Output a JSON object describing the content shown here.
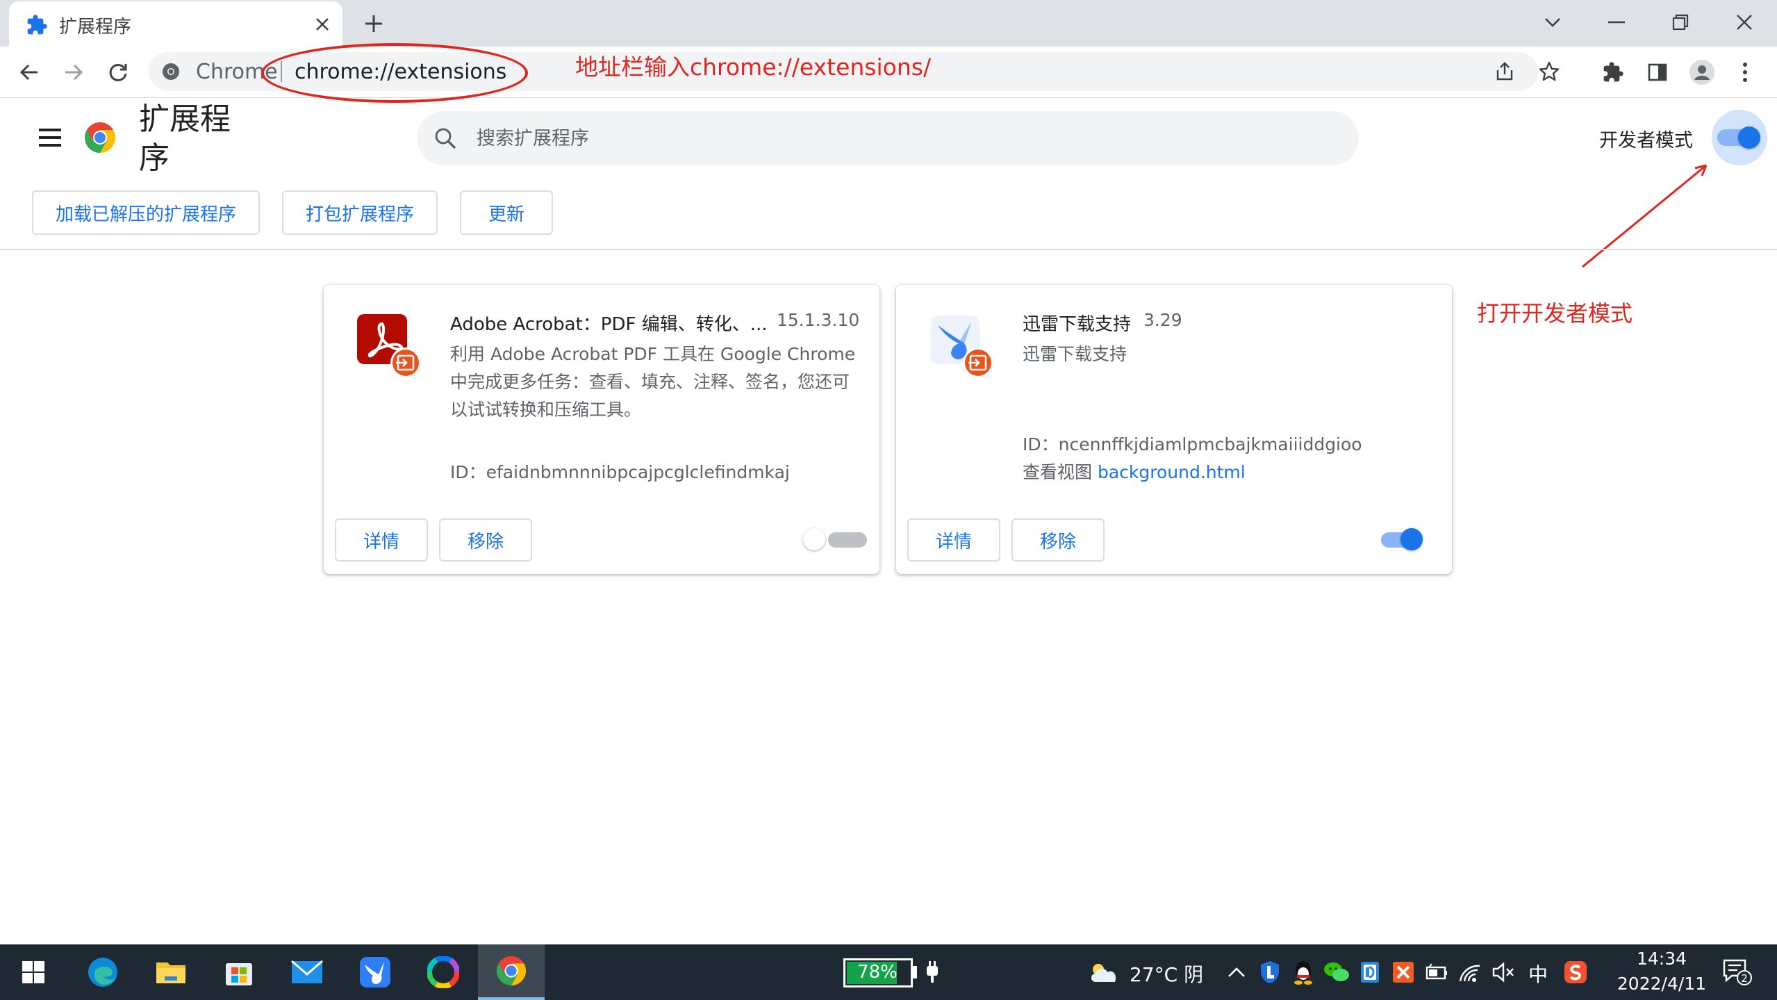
{
  "browser": {
    "tab_title": "扩展程序",
    "omnibox_scheme_label": "Chrome",
    "omnibox_url": "chrome://extensions"
  },
  "annotations": {
    "address_hint": "地址栏输入chrome://extensions/",
    "devmode_hint": "打开开发者模式",
    "color": "#e0261f"
  },
  "page": {
    "title": "扩展程序",
    "search_placeholder": "搜索扩展程序",
    "developer_mode_label": "开发者模式",
    "developer_mode_on": true,
    "buttons": {
      "load_unpacked": "加载已解压的扩展程序",
      "pack": "打包扩展程序",
      "update": "更新"
    }
  },
  "extensions": [
    {
      "name": "Adobe Acrobat：PDF 编辑、转化、...",
      "version": "15.1.3.10",
      "description": "利用 Adobe Acrobat PDF 工具在 Google Chrome 中完成更多任务：查看、填充、注释、签名，您还可以试试转换和压缩工具。",
      "id_text": "ID：efaidnbmnnnibpcajpcglclefindmkaj",
      "details_label": "详情",
      "remove_label": "移除",
      "enabled": false
    },
    {
      "name": "迅雷下载支持",
      "version": "3.29",
      "description": "迅雷下载支持",
      "id_text": "ID：ncennffkjdiamlpmcbajkmaiiiddgioo",
      "inspect_label": "查看视图",
      "inspect_link": "background.html",
      "details_label": "详情",
      "remove_label": "移除",
      "enabled": true
    }
  ],
  "taskbar": {
    "battery_percent": "78%",
    "weather": "27°C 阴",
    "ime": "中",
    "time": "14:34",
    "date": "2022/4/11",
    "notification_count": "2"
  },
  "colors": {
    "accent": "#1a73e8",
    "accent_light": "#8ab4f8",
    "taskbar": "#1f2933",
    "battery": "#14a34a"
  }
}
